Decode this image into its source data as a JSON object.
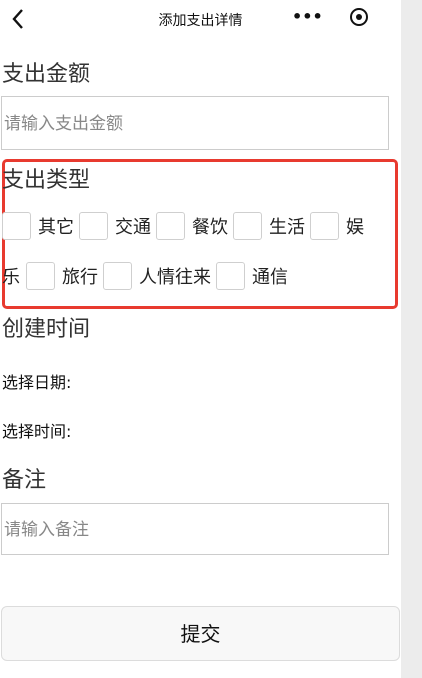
{
  "navbar": {
    "back_icon": "‹",
    "title": "添加支出详情",
    "more_icon": "•••",
    "record_icon": "target-icon"
  },
  "amount": {
    "label": "支出金额",
    "placeholder": "请输入支出金额"
  },
  "category": {
    "label": "支出类型",
    "row1": [
      "其它",
      "交通",
      "餐饮",
      "生活",
      "娱"
    ],
    "row2_lead": "乐",
    "row2": [
      "旅行",
      "人情往来",
      "通信"
    ],
    "highlight_color": "#e83a2f"
  },
  "created": {
    "label": "创建时间",
    "date_label": "选择日期:",
    "time_label": "选择时间:"
  },
  "note": {
    "label": "备注",
    "placeholder": "请输入备注"
  },
  "submit_label": "提交"
}
